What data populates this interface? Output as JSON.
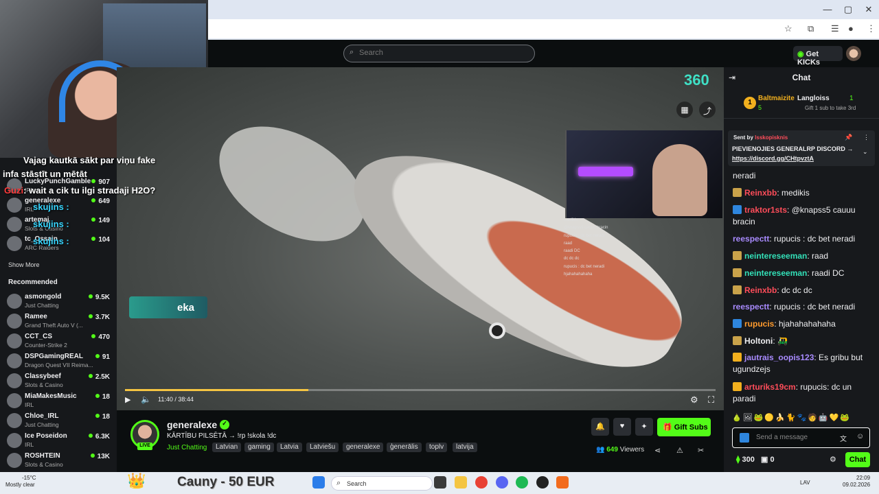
{
  "browser": {
    "window_controls": [
      "—",
      "▢",
      "✕"
    ],
    "toolbar_icons": [
      "star-icon",
      "extension-icon",
      "menu-list-icon",
      "profile-icon",
      "more-icon"
    ]
  },
  "header": {
    "search_placeholder": "Search",
    "get_kicks": "Get KICKs"
  },
  "overlay": {
    "line1": "Vajag kautkā sākt par viņu fake",
    "line2": "infa stāstīt un mētāt",
    "line3_user": "Guzi",
    "line3_text": ": wait a cik tu ilgi stradaji H2O?",
    "tag_a": "skujins :",
    "tag_b": "skujins :",
    "tag_c": "skujins :",
    "logo_360": "360",
    "eka_text": "eka"
  },
  "sidebar": {
    "following": [
      {
        "name": "LuckyPunchGamble",
        "category": "IRL",
        "count": "907"
      },
      {
        "name": "generalexe",
        "category": "IRL",
        "count": "649"
      },
      {
        "name": "artemaj",
        "category": "Slots & Casino",
        "count": "149"
      },
      {
        "name": "tc_Ossain",
        "category": "ARC Raiders",
        "count": "104"
      }
    ],
    "show_more": "Show More",
    "recommended_label": "Recommended",
    "recommended": [
      {
        "name": "asmongold",
        "category": "Just Chatting",
        "count": "9.5K"
      },
      {
        "name": "Ramee",
        "category": "Grand Theft Auto V (...",
        "count": "3.7K"
      },
      {
        "name": "CCT_CS",
        "category": "Counter-Strike 2",
        "count": "470"
      },
      {
        "name": "DSPGamingREAL",
        "category": "Dragon Quest VII Reima...",
        "count": "91"
      },
      {
        "name": "Classybeef",
        "category": "Slots & Casino",
        "count": "2.5K"
      },
      {
        "name": "MiaMakesMusic",
        "category": "IRL",
        "count": "18"
      },
      {
        "name": "Chloe_IRL",
        "category": "Just Chatting",
        "count": "18"
      },
      {
        "name": "Ice Poseidon",
        "category": "IRL",
        "count": "6.3K"
      },
      {
        "name": "ROSHTEIN",
        "category": "Slots & Casino",
        "count": "13K"
      }
    ]
  },
  "player": {
    "progress": 0.31,
    "time_current": "11:40",
    "time_sep": "/",
    "time_total": "38:44"
  },
  "mini_chat": [
    "medikis",
    "@knapss5 cauuu bracin",
    "rupucis : dc bet neradi",
    "raad",
    "raadi DC",
    "dc dc dc",
    "rupucis : dc bet neradi",
    "hjahahahahaha"
  ],
  "channel": {
    "name": "generalexe",
    "live": "LIVE",
    "title": "KĀRTĪBU PILSĒTĀ → !rp !skola !dc",
    "category": "Just Chatting",
    "tags": [
      "Latvian",
      "gaming",
      "Latvia",
      "Latviešu",
      "generalexe",
      "ģenerālis",
      "toplv",
      "latvija"
    ],
    "gift_subs": "Gift Subs",
    "viewers": "649",
    "viewers_label": "Viewers"
  },
  "chat": {
    "title": "Chat",
    "leaderboard": {
      "rank": "1",
      "user1": "Baltmaizite",
      "user1_count": "5",
      "user2": "Langloiss",
      "user2_count": "1",
      "user2_note": "Gift 1 sub to take 3rd"
    },
    "pinned": {
      "sent_by": "Sent by",
      "sender": "lsskopisknis",
      "text": "PIEVIENOJIES GENERALRP DISCORD →",
      "link": "https://discord.gg/CHtpvztA"
    },
    "messages": [
      {
        "user": "",
        "text": "neradi",
        "color": "#efeff1"
      },
      {
        "user": "Reinxbb",
        "text": ": medikis",
        "color": "#ff4d5a"
      },
      {
        "user": "traktor1sts",
        "text": ": @knapss5 cauuu bracin",
        "color": "#ff4d5a"
      },
      {
        "user": "reespectt",
        "text": ": rupucis : dc bet neradi",
        "color": "#a98bff"
      },
      {
        "user": "neintereseeman",
        "text": ": raad",
        "color": "#33e0b8"
      },
      {
        "user": "neintereseeman",
        "text": ": raadi DC",
        "color": "#33e0b8"
      },
      {
        "user": "Reinxbb",
        "text": ": dc dc dc",
        "color": "#ff4d5a"
      },
      {
        "user": "reespectt",
        "text": ": rupucis : dc bet neradi",
        "color": "#a98bff"
      },
      {
        "user": "rupucis",
        "text": ": hjahahahahaha",
        "color": "#ff9b2e"
      },
      {
        "user": "Holtoni",
        "text": ":",
        "color": "#efeff1"
      },
      {
        "user": "jautrais_oopis123",
        "text": ": Es gribu but ugundzejs",
        "color": "#a98bff"
      },
      {
        "user": "arturiks19cm",
        "text": ": rupucis: dc un paradi",
        "color": "#ff4d5a"
      }
    ],
    "input_placeholder": "Send a message",
    "points": "300",
    "drops": "0",
    "send": "Chat"
  },
  "taskbar": {
    "temp": "-15°C",
    "weather": "Mostly clear",
    "ticker": "Cauny - 50 EUR",
    "search": "Search",
    "lang": "LAV",
    "time": "22:09",
    "date": "09.02.2026"
  },
  "colors": {
    "kick_green": "#53fc18",
    "bg": "#0b0e0f",
    "panel": "#17191c"
  }
}
